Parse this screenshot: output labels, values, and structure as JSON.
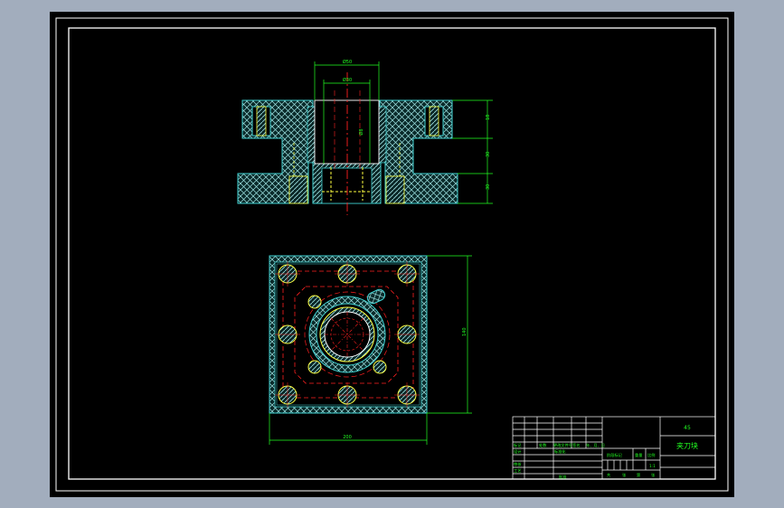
{
  "colors": {
    "bg": "#a2adbd",
    "paper": "#000000",
    "frame": "#ffffff",
    "part": "#3fd0d0",
    "hatch": "#a9e7e7",
    "center": "#ff2020",
    "bolt": "#ffff40",
    "dim": "#22ff22"
  },
  "dims": {
    "top_outer": "Ø50",
    "top_inner": "Ø30",
    "hole": "Ø8",
    "h1": "18",
    "h2": "30",
    "h3": "30",
    "height": "140",
    "width": "200"
  },
  "title_block": {
    "drawing_name": "夹刀块",
    "scale": "1:1",
    "material": "45",
    "row_design": "设计",
    "row_std": "标准化",
    "row_audit": "审核",
    "row_process": "工艺",
    "row_approve": "批准",
    "row_mark": "标记",
    "row_count": "处数",
    "row_file": "更改文件号",
    "row_sign": "签名",
    "row_date": "年、月、日",
    "stage_label": "阶段标记",
    "weight_label": "重量",
    "scale_label": "比例",
    "sheet_total": "共",
    "sheet_of": "张",
    "sheet_no": "第",
    "sheet_end": "张"
  }
}
